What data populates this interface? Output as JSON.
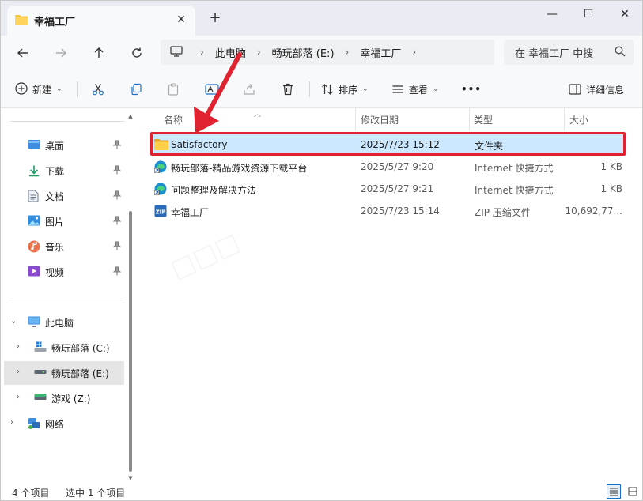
{
  "window": {
    "tab_title": "幸福工厂",
    "tab_close": "✕",
    "new_tab": "+",
    "minimize": "—",
    "maximize": "☐",
    "close": "✕"
  },
  "address": {
    "breadcrumbs": [
      "此电脑",
      "畅玩部落 (E:)",
      "幸福工厂"
    ],
    "separator": "›",
    "search_placeholder": "在 幸福工厂 中搜"
  },
  "toolbar": {
    "new_label": "新建",
    "sort_label": "排序",
    "view_label": "查看",
    "more_label": "•••",
    "details_label": "详细信息"
  },
  "sidebar": {
    "quick_access": [
      {
        "label": "桌面",
        "icon": "desktop-icon"
      },
      {
        "label": "下载",
        "icon": "download-icon"
      },
      {
        "label": "文档",
        "icon": "documents-icon"
      },
      {
        "label": "图片",
        "icon": "pictures-icon"
      },
      {
        "label": "音乐",
        "icon": "music-icon"
      },
      {
        "label": "视频",
        "icon": "videos-icon"
      }
    ],
    "this_pc": "此电脑",
    "drives": [
      {
        "label": "畅玩部落 (C:)",
        "icon": "windows-drive-icon"
      },
      {
        "label": "畅玩部落 (E:)",
        "icon": "drive-icon"
      },
      {
        "label": "游戏 (Z:)",
        "icon": "drive-icon"
      }
    ],
    "network": "网络"
  },
  "columns": {
    "name": "名称",
    "date": "修改日期",
    "type": "类型",
    "size": "大小"
  },
  "files": [
    {
      "name": "Satisfactory",
      "date": "2025/7/23 15:12",
      "type": "文件夹",
      "size": "",
      "icon": "folder-icon"
    },
    {
      "name": "畅玩部落-精品游戏资源下载平台",
      "date": "2025/5/27 9:20",
      "type": "Internet 快捷方式",
      "size": "1 KB",
      "icon": "edge-shortcut-icon"
    },
    {
      "name": "问题整理及解决方法",
      "date": "2025/5/27 9:21",
      "type": "Internet 快捷方式",
      "size": "1 KB",
      "icon": "edge-shortcut-icon"
    },
    {
      "name": "幸福工厂",
      "date": "2025/7/23 15:14",
      "type": "ZIP 压缩文件",
      "size": "10,692,77...",
      "icon": "zip-icon"
    }
  ],
  "status": {
    "count": "4 个项目",
    "selected": "选中 1 个项目"
  },
  "colors": {
    "selection": "#cce8ff",
    "highlight": "#e02331",
    "folder": "#f5c242",
    "accent": "#1a6fc9"
  }
}
